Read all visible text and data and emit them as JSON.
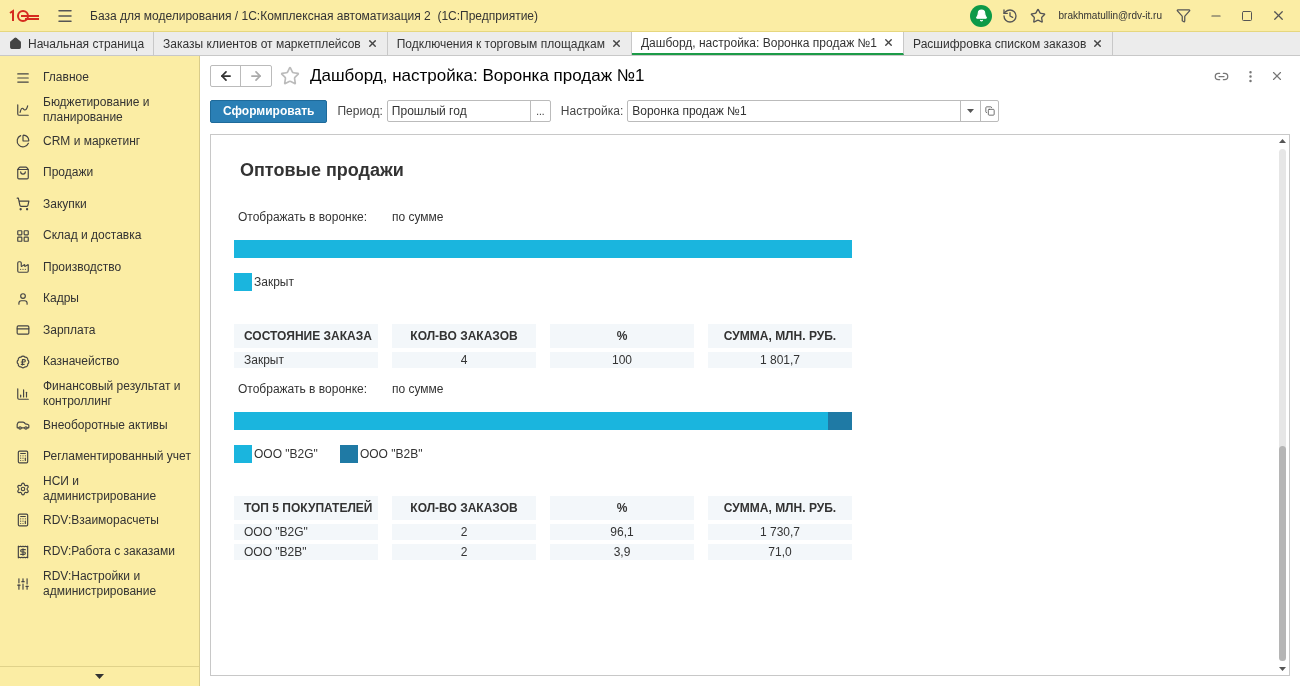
{
  "app": {
    "title": "База для моделирования / 1С:Комплексная автоматизация 2  (1С:Предприятие)",
    "user": "brakhmatullin@rdv-it.ru"
  },
  "tabs": [
    {
      "kind": "home",
      "label": "Начальная страница",
      "selected": false
    },
    {
      "kind": "page",
      "label": "Заказы клиентов от маркетплейсов",
      "selected": false
    },
    {
      "kind": "page",
      "label": "Подключения к торговым площадкам",
      "selected": false
    },
    {
      "kind": "page",
      "label": "Дашборд, настройка: Воронка продаж №1",
      "selected": true
    },
    {
      "kind": "page",
      "label": "Расшифровка списком заказов",
      "selected": false
    }
  ],
  "sidebar": {
    "items": [
      {
        "label": "Главное"
      },
      {
        "label": "Бюджетирование и планирование"
      },
      {
        "label": "CRM и маркетинг"
      },
      {
        "label": "Продажи"
      },
      {
        "label": "Закупки"
      },
      {
        "label": "Склад и доставка"
      },
      {
        "label": "Производство"
      },
      {
        "label": "Кадры"
      },
      {
        "label": "Зарплата"
      },
      {
        "label": "Казначейство"
      },
      {
        "label": "Финансовый результат и контроллинг"
      },
      {
        "label": "Внеоборотные активы"
      },
      {
        "label": "Регламентированный учет"
      },
      {
        "label": "НСИ и администрирование"
      },
      {
        "label": "RDV:Взаиморасчеты"
      },
      {
        "label": "RDV:Работа с заказами"
      },
      {
        "label": "RDV:Настройки и администрирование"
      }
    ]
  },
  "form": {
    "title": "Дашборд, настройка: Воронка продаж №1",
    "generate_button": "Сформировать",
    "period": {
      "label": "Период:",
      "value": "Прошлый год",
      "button": "..."
    },
    "setting": {
      "label": "Настройка:",
      "value": "Воронка продаж №1"
    }
  },
  "report": {
    "heading": "Оптовые продажи",
    "sections": [
      {
        "display_label": "Отображать в воронке:",
        "display_value": "по сумме",
        "legend": [
          {
            "name": "Закрыт",
            "color": "#1ab5de"
          }
        ],
        "table": {
          "columns": [
            "СОСТОЯНИЕ ЗАКАЗА",
            "КОЛ-ВО ЗАКАЗОВ",
            "%",
            "СУММА, МЛН. РУБ."
          ],
          "rows": [
            [
              "Закрыт",
              "4",
              "100",
              "1 801,7"
            ]
          ]
        }
      },
      {
        "display_label": "Отображать в воронке:",
        "display_value": "по сумме",
        "bar": {
          "level": 0.961
        },
        "legend": [
          {
            "name": "ООО \"B2G\"",
            "color": "#1ab5de"
          },
          {
            "name": "ООО \"B2B\"",
            "color": "#1f7aa5"
          }
        ],
        "table": {
          "columns": [
            "ТОП 5 ПОКУПАТЕЛЕЙ",
            "КОЛ-ВО ЗАКАЗОВ",
            "%",
            "СУММА, МЛН. РУБ."
          ],
          "rows": [
            [
              "ООО \"B2G\"",
              "2",
              "96,1",
              "1 730,7"
            ],
            [
              "ООО \"B2B\"",
              "2",
              "3,9",
              "71,0"
            ]
          ]
        }
      }
    ]
  }
}
